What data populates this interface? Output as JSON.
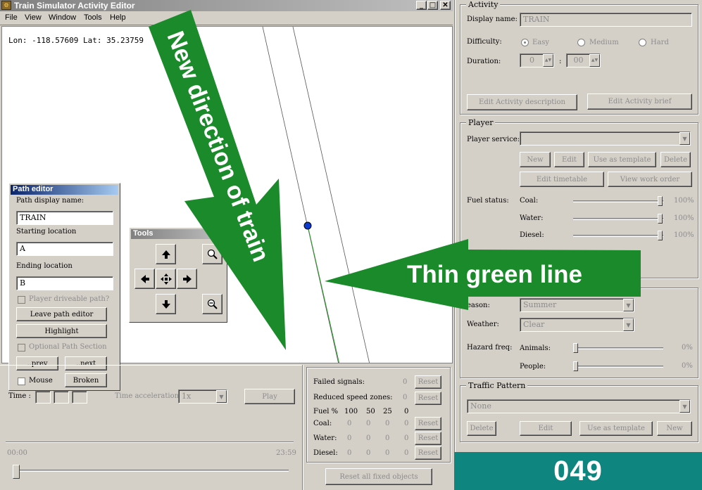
{
  "window": {
    "title": "Train Simulator Activity Editor",
    "menu": [
      "File",
      "View",
      "Window",
      "Tools",
      "Help"
    ],
    "minimize_glyph": "_",
    "maximize_glyph": "□",
    "close_glyph": "✕"
  },
  "map": {
    "coords": "Lon: -118.57609 Lat: 35.23759"
  },
  "path_editor": {
    "title": "Path editor",
    "display_name_label": "Path display name:",
    "display_name_value": "TRAIN",
    "start_label": "Starting location",
    "start_value": "A",
    "end_label": "Ending location",
    "end_value": "B",
    "driveable_label": "Player driveable path?",
    "leave_label": "Leave path editor",
    "highlight_label": "Highlight",
    "optional_label": "Optional Path Section",
    "prev_label": "..prev",
    "next_label": "..next",
    "mouse_label": "Mouse",
    "broken_label": "Broken"
  },
  "tools": {
    "title": "Tools"
  },
  "timeline": {
    "time_label": "Time :",
    "accel_label": "Time acceleration",
    "accel_value": "1x",
    "play_label": "Play",
    "start_time": "00:00",
    "end_time": "23:59"
  },
  "stats": {
    "failed_signals_label": "Failed signals:",
    "failed_signals_value": "0",
    "reduced_speed_label": "Reduced speed zones:",
    "reduced_speed_value": "0",
    "fuel_header": "Fuel %",
    "fuel_levels": [
      "100",
      "50",
      "25",
      "0"
    ],
    "rows": [
      {
        "label": "Coal:",
        "values": [
          "0",
          "0",
          "0",
          "0"
        ]
      },
      {
        "label": "Water:",
        "values": [
          "0",
          "0",
          "0",
          "0"
        ]
      },
      {
        "label": "Diesel:",
        "values": [
          "0",
          "0",
          "0",
          "0"
        ]
      }
    ],
    "reset_label": "Reset",
    "reset_all_label": "Reset all fixed objects"
  },
  "activity": {
    "group_title": "Activity",
    "display_name_label": "Display name:",
    "display_name_value": "TRAIN",
    "difficulty_label": "Difficulty:",
    "difficulty_options": [
      "Easy",
      "Medium",
      "Hard"
    ],
    "duration_label": "Duration:",
    "duration_hours": "0",
    "duration_minutes": "00",
    "duration_sep": ":",
    "edit_description_label": "Edit Activity description",
    "edit_brief_label": "Edit Activity brief"
  },
  "player": {
    "group_title": "Player",
    "service_label": "Player service:",
    "new_label": "New",
    "edit_label": "Edit",
    "template_label": "Use as template",
    "delete_label": "Delete",
    "edit_timetable_label": "Edit timetable",
    "view_work_order_label": "View work order",
    "fuel_status_label": "Fuel status:",
    "fuel": [
      {
        "label": "Coal:",
        "percent": "100%",
        "level": 1.0
      },
      {
        "label": "Water:",
        "percent": "100%",
        "level": 1.0
      },
      {
        "label": "Diesel:",
        "percent": "100%",
        "level": 1.0
      }
    ]
  },
  "environment": {
    "season_label": "eason:",
    "season_value": "Summer",
    "weather_label": "Weather:",
    "weather_value": "Clear",
    "hazard_label": "Hazard freq:",
    "animals_label": "Animals:",
    "animals_percent": "0%",
    "people_label": "People:",
    "people_percent": "0%"
  },
  "traffic": {
    "group_title": "Traffic Pattern",
    "pattern_value": "None",
    "delete_label": "Delete",
    "edit_label": "Edit",
    "template_label": "Use as template",
    "new_label": "New"
  },
  "annotations": {
    "arrow1_text": "New direction of train",
    "arrow2_text": "Thin green line",
    "badge_number": "049",
    "arrow_color": "#1a8a2a",
    "badge_color": "#0f8580"
  }
}
